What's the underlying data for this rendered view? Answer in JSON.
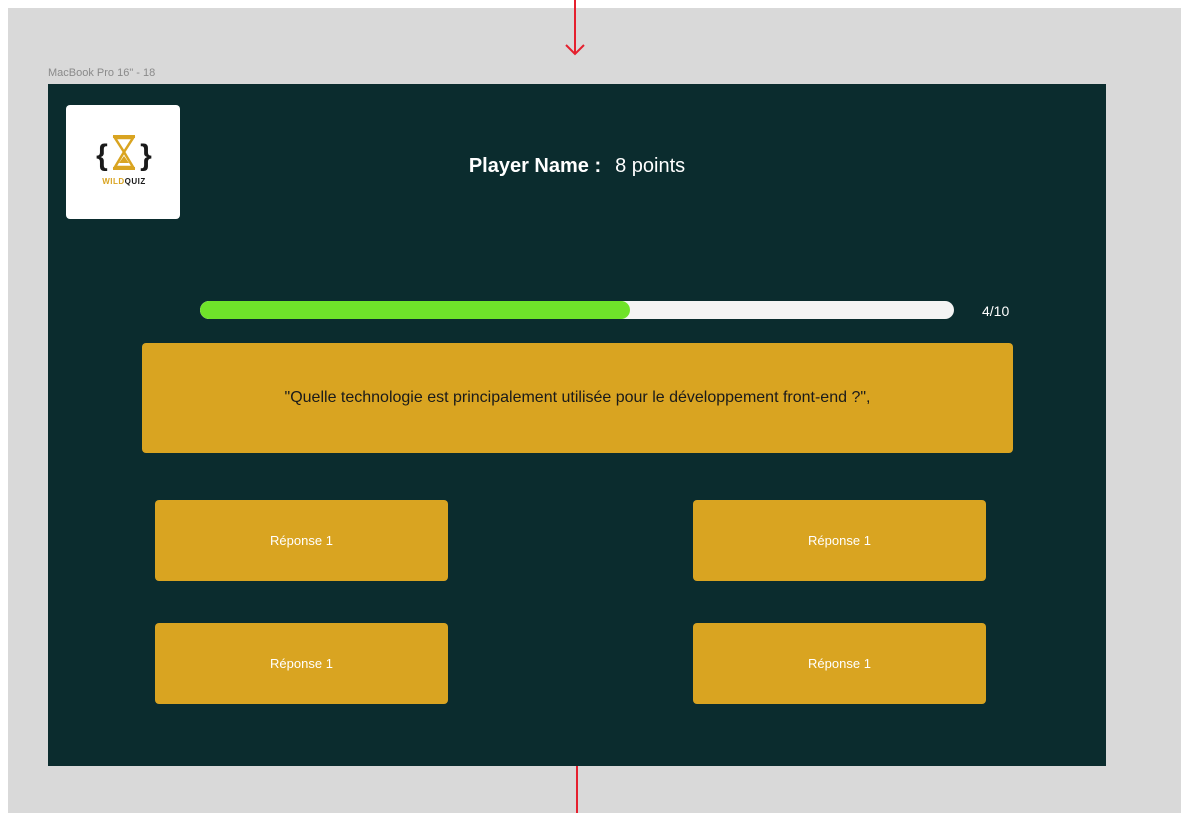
{
  "canvas": {
    "frame_label": "MacBook Pro 16\" - 18"
  },
  "logo": {
    "brace_left": "{",
    "brace_right": "}",
    "text_wild": "WILD",
    "text_quiz": "QUIZ",
    "icon": "hourglass-icon",
    "colors": {
      "brace": "#1a1a1a",
      "hourglass": "#d9a421",
      "wild": "#d9a421",
      "quiz": "#1a1a1a"
    }
  },
  "header": {
    "player_label": "Player Name :",
    "score": "8 points"
  },
  "progress": {
    "value": 0.57,
    "count_text": "4/10",
    "colors": {
      "fill": "#6fe32a",
      "track": "#f4f4f4"
    }
  },
  "question": {
    "text": "\"Quelle technologie est principalement utilisée pour le développement front-end ?\","
  },
  "answers": [
    {
      "label": "Réponse 1"
    },
    {
      "label": "Réponse 1"
    },
    {
      "label": "Réponse 1"
    },
    {
      "label": "Réponse 1"
    }
  ],
  "colors": {
    "frame_bg": "#0b2c2e",
    "accent": "#d9a421",
    "flow_arrow": "#e5202e"
  }
}
